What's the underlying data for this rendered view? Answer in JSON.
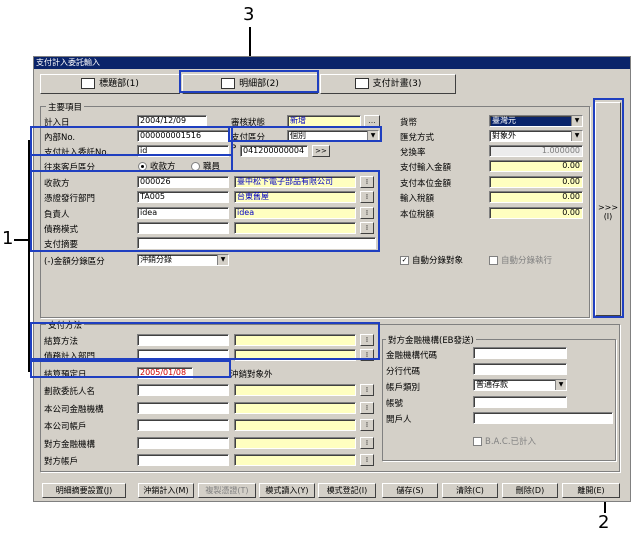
{
  "window": {
    "title": "支付計入委託輸入"
  },
  "tabs": [
    {
      "label": "標題部(1)"
    },
    {
      "label": "明細部(2)"
    },
    {
      "label": "支付計畫(3)"
    }
  ],
  "callouts": {
    "c1": "1",
    "c2": "2",
    "c3": "3"
  },
  "main_section": {
    "title": "主要項目",
    "entry_date": {
      "label": "計入日",
      "value": "2004/12/09"
    },
    "review_status": {
      "label": "審核狀態",
      "value": "新增"
    },
    "internal_no": {
      "label": "內部No.",
      "value": "000000001516"
    },
    "payment_division": {
      "label": "支付區分",
      "value": "個別"
    },
    "payment_request_no": {
      "label": "支付計入委託No.",
      "value": "id"
    },
    "p_code": {
      "label": "P",
      "value": "041200000004",
      "button": ">>"
    },
    "partner_division": {
      "label": "往來客戶區分",
      "options": [
        "收款方",
        "職員"
      ]
    },
    "payee": {
      "label": "收款方",
      "code": "000026",
      "name": "臺中松下電子部品有限公司"
    },
    "voucher_dept": {
      "label": "憑證發行部門",
      "code": "TA005",
      "name": "台東舊屋"
    },
    "person_in_charge": {
      "label": "負責人",
      "code": "idea",
      "name": "idea"
    },
    "debt_mode": {
      "label": "債務模式"
    },
    "payment_summary": {
      "label": "支付摘要"
    },
    "amount_division": {
      "label": "(-)金額分錄區分",
      "value": "沖銷分錄"
    },
    "currency": {
      "label": "貨幣",
      "value": "臺灣元"
    },
    "exchange_method": {
      "label": "匯兌方式",
      "value": "對象外"
    },
    "exchange_rate": {
      "label": "兌換率",
      "value": "1.000000"
    },
    "payment_input_amount": {
      "label": "支付輸入金額",
      "value": "0.00"
    },
    "payment_base_amount": {
      "label": "支付本位金額",
      "value": "0.00"
    },
    "input_tax": {
      "label": "輸入稅額",
      "value": "0.00"
    },
    "base_tax": {
      "label": "本位稅額",
      "value": "0.00"
    },
    "auto_split_target": {
      "label": "自動分錄對象"
    },
    "auto_split_exec": {
      "label": "自動分錄執行"
    }
  },
  "side_button": {
    "label": ">>>",
    "sub": "(I)"
  },
  "payment_section": {
    "title": "支付方法",
    "settlement_method": {
      "label": "結算方法"
    },
    "debt_dept": {
      "label": "債務計入部門"
    },
    "settlement_date": {
      "label": "結算預定日",
      "value": "2005/01/08",
      "note": "沖銷對象外"
    },
    "transfer_requester": {
      "label": "劃款委託人名"
    },
    "company_bank": {
      "label": "本公司金融機構"
    },
    "company_account": {
      "label": "本公司帳戶"
    },
    "counter_bank": {
      "label": "對方金融機構"
    },
    "counter_account": {
      "label": "對方帳戶"
    }
  },
  "eb_section": {
    "title": "對方金融機構(EB發送)",
    "bank_code": {
      "label": "金融機構代碼"
    },
    "branch_code": {
      "label": "分行代碼"
    },
    "account_type": {
      "label": "帳戶類別",
      "value": "普通存款"
    },
    "account_no": {
      "label": "帳號"
    },
    "account_holder": {
      "label": "開戶人"
    },
    "bac": {
      "label": "B.A.C.已計入"
    }
  },
  "buttons": [
    {
      "label": "明細摘要設置(J)"
    },
    {
      "label": "沖銷計入(M)"
    },
    {
      "label": "複製憑證(T)"
    },
    {
      "label": "模式讀入(Y)"
    },
    {
      "label": "模式登記(I)"
    },
    {
      "label": "儲存(S)"
    },
    {
      "label": "清除(C)"
    },
    {
      "label": "刪除(D)"
    },
    {
      "label": "離開(E)"
    }
  ]
}
